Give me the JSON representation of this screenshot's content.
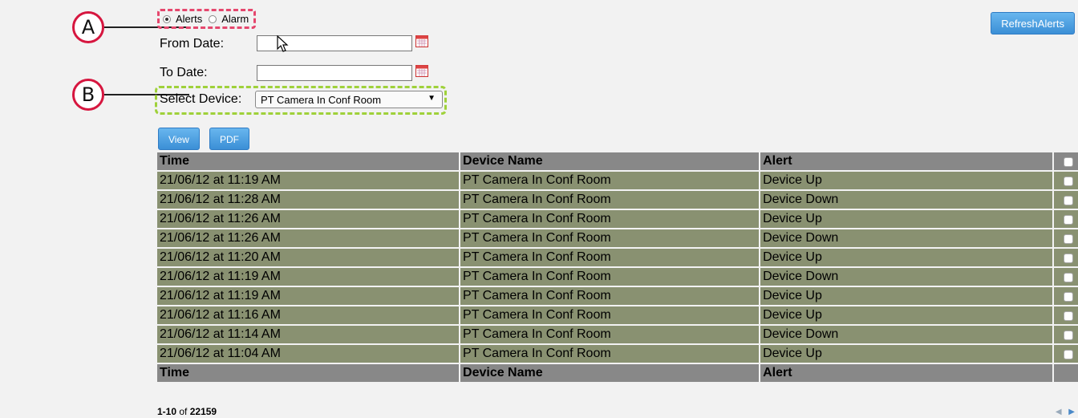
{
  "callouts": {
    "a": "A",
    "b": "B"
  },
  "mode": {
    "options": [
      {
        "label": "Alerts",
        "checked": true
      },
      {
        "label": "Alarm",
        "checked": false
      }
    ]
  },
  "filters": {
    "from_label": "From Date:",
    "from_value": "",
    "to_label": "To Date:",
    "to_value": "",
    "device_label": "Select Device:",
    "device_value": "PT Camera In Conf Room"
  },
  "buttons": {
    "refresh": "RefreshAlerts",
    "view": "View",
    "pdf": "PDF"
  },
  "table": {
    "headers": [
      "Time",
      "Device Name",
      "Alert"
    ],
    "rows": [
      [
        "21/06/12 at 11:19 AM",
        "PT Camera In Conf Room",
        "Device Up"
      ],
      [
        "21/06/12 at 11:28 AM",
        "PT Camera In Conf Room",
        "Device Down"
      ],
      [
        "21/06/12 at 11:26 AM",
        "PT Camera In Conf Room",
        "Device Up"
      ],
      [
        "21/06/12 at 11:26 AM",
        "PT Camera In Conf Room",
        "Device Down"
      ],
      [
        "21/06/12 at 11:20 AM",
        "PT Camera In Conf Room",
        "Device Up"
      ],
      [
        "21/06/12 at 11:19 AM",
        "PT Camera In Conf Room",
        "Device Down"
      ],
      [
        "21/06/12 at 11:19 AM",
        "PT Camera In Conf Room",
        "Device Up"
      ],
      [
        "21/06/12 at 11:16 AM",
        "PT Camera In Conf Room",
        "Device Up"
      ],
      [
        "21/06/12 at 11:14 AM",
        "PT Camera In Conf Room",
        "Device Down"
      ],
      [
        "21/06/12 at 11:04 AM",
        "PT Camera In Conf Room",
        "Device Up"
      ]
    ]
  },
  "pagination": {
    "range": "1-10",
    "of": "of",
    "total": "22159"
  },
  "colors": {
    "row_bg": "#899171",
    "header_bg": "#888888",
    "button": "#3b8fd6",
    "callout": "#d6163f"
  },
  "icons": [
    "calendar-icon",
    "dropdown-arrow-icon",
    "checkbox-icon",
    "mouse-cursor-icon",
    "prev-page-icon",
    "next-page-icon"
  ]
}
